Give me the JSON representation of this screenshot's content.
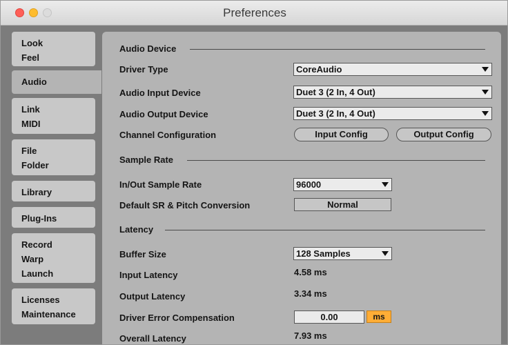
{
  "window": {
    "title": "Preferences"
  },
  "sidebar": {
    "tabs": [
      {
        "lines": [
          "Look",
          "Feel"
        ]
      },
      {
        "lines": [
          "Audio"
        ],
        "active": true
      },
      {
        "lines": [
          "Link",
          "MIDI"
        ]
      },
      {
        "lines": [
          "File",
          "Folder"
        ]
      },
      {
        "lines": [
          "Library"
        ]
      },
      {
        "lines": [
          "Plug-Ins"
        ]
      },
      {
        "lines": [
          "Record",
          "Warp",
          "Launch"
        ]
      },
      {
        "lines": [
          "Licenses",
          "Maintenance"
        ]
      }
    ]
  },
  "audio_device": {
    "heading": "Audio Device",
    "driver_type": {
      "label": "Driver Type",
      "value": "CoreAudio"
    },
    "input_device": {
      "label": "Audio Input Device",
      "value": "Duet 3 (2 In, 4 Out)"
    },
    "output_device": {
      "label": "Audio Output Device",
      "value": "Duet 3 (2 In, 4 Out)"
    },
    "channel_config": {
      "label": "Channel Configuration",
      "input_button": "Input Config",
      "output_button": "Output Config"
    }
  },
  "sample_rate": {
    "heading": "Sample Rate",
    "io_rate": {
      "label": "In/Out Sample Rate",
      "value": "96000"
    },
    "default_sr": {
      "label": "Default SR & Pitch Conversion",
      "value": "Normal"
    }
  },
  "latency": {
    "heading": "Latency",
    "buffer_size": {
      "label": "Buffer Size",
      "value": "128 Samples"
    },
    "input_latency": {
      "label": "Input Latency",
      "value": "4.58 ms"
    },
    "output_latency": {
      "label": "Output Latency",
      "value": "3.34 ms"
    },
    "driver_error": {
      "label": "Driver Error Compensation",
      "value": "0.00",
      "unit": "ms"
    },
    "overall_latency": {
      "label": "Overall Latency",
      "value": "7.93 ms"
    }
  },
  "colors": {
    "accent_orange": "#ffad36",
    "panel": "#b4b4b4",
    "tab": "#c8c8c8",
    "background": "#7c7c7c"
  }
}
